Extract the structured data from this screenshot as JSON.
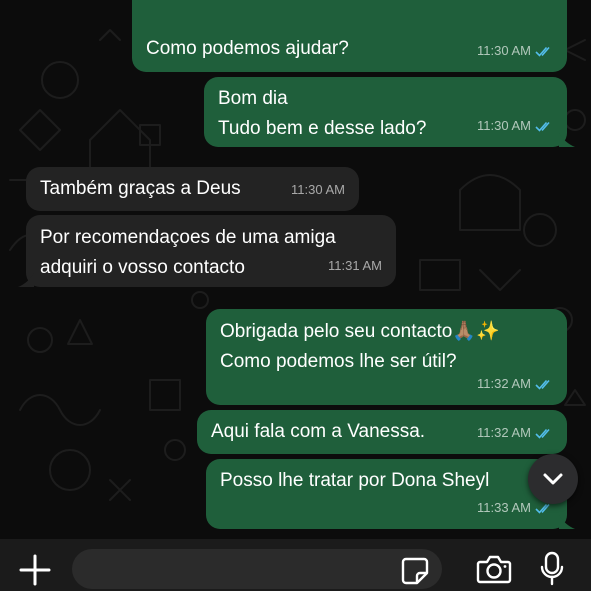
{
  "messages": [
    {
      "text_lines": [
        "Como podemos ajudar?"
      ],
      "time": "11:30 AM",
      "direction": "outgoing",
      "status": "read"
    },
    {
      "text_lines": [
        "Bom dia",
        "Tudo bem e desse lado?"
      ],
      "time": "11:30 AM",
      "direction": "outgoing",
      "status": "read"
    },
    {
      "text_lines": [
        "Também graças a Deus"
      ],
      "time": "11:30 AM",
      "direction": "incoming"
    },
    {
      "text_lines": [
        "Por recomendaçoes de uma amiga",
        "adquiri o vosso contacto"
      ],
      "time": "11:31 AM",
      "direction": "incoming"
    },
    {
      "text_lines": [
        "Obrigada pelo seu contacto🙏🏽✨",
        "Como podemos lhe ser útil?"
      ],
      "time": "11:32 AM",
      "direction": "outgoing",
      "status": "read"
    },
    {
      "text_lines": [
        "Aqui fala com a Vanessa."
      ],
      "time": "11:32 AM",
      "direction": "outgoing",
      "status": "read"
    },
    {
      "text_lines": [
        "Posso lhe tratar por Dona Sheyl"
      ],
      "time": "11:33 AM",
      "direction": "outgoing",
      "status": "read"
    }
  ],
  "input": {
    "value": "",
    "placeholder": ""
  },
  "icons": {
    "attach": "plus-icon",
    "sticker": "sticker-icon",
    "camera": "camera-icon",
    "voice": "microphone-icon",
    "scroll": "chevron-down-icon",
    "read_receipt": "double-check-icon"
  },
  "colors": {
    "outgoing_bubble": "#1f5f3b",
    "incoming_bubble": "#232323",
    "read_tick": "#53bdeb",
    "background": "#0c0c0c",
    "input_bar": "#1b1b1b"
  }
}
